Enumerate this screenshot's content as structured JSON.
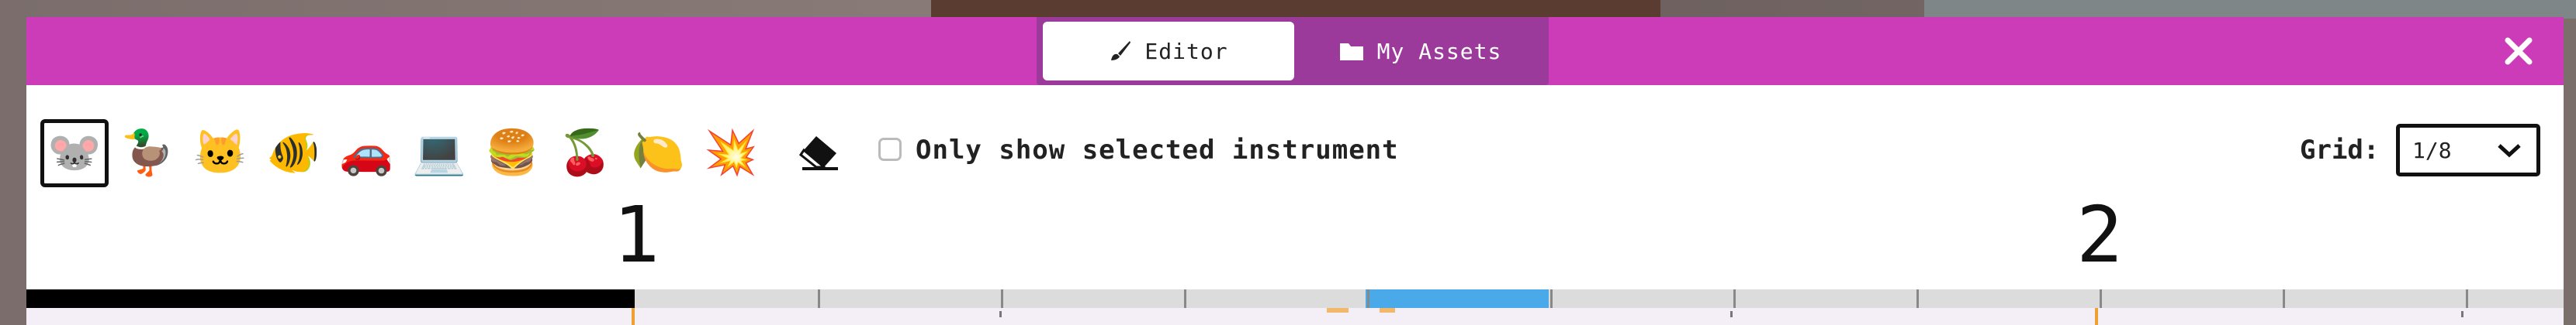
{
  "tabs": {
    "editor": {
      "label": "Editor",
      "icon": "brush-icon",
      "active": true
    },
    "assets": {
      "label": "My Assets",
      "icon": "folder-icon",
      "active": false
    }
  },
  "close_icon": "close-icon",
  "instruments": [
    {
      "name": "mouse",
      "glyph": "🐭",
      "selected": true
    },
    {
      "name": "duck",
      "glyph": "🦆",
      "selected": false
    },
    {
      "name": "cat",
      "glyph": "🐱",
      "selected": false
    },
    {
      "name": "fish",
      "glyph": "🐠",
      "selected": false
    },
    {
      "name": "car",
      "glyph": "🚗",
      "selected": false
    },
    {
      "name": "computer",
      "glyph": "💻",
      "selected": false
    },
    {
      "name": "burger",
      "glyph": "🍔",
      "selected": false
    },
    {
      "name": "cherry",
      "glyph": "🍒",
      "selected": false
    },
    {
      "name": "lemon",
      "glyph": "🍋",
      "selected": false
    },
    {
      "name": "explosion",
      "glyph": "💥",
      "selected": false
    }
  ],
  "eraser_icon": "eraser-icon",
  "only_selected": {
    "label": "Only show selected instrument",
    "checked": false
  },
  "grid": {
    "label": "Grid:",
    "value": "1/8"
  },
  "measures": [
    "1",
    "2"
  ],
  "colors": {
    "topbar": "#cc3bb8",
    "tab_group": "#9b3a9a",
    "loop_region": "#4aa9e8",
    "playhead_marker": "#f0a030"
  }
}
